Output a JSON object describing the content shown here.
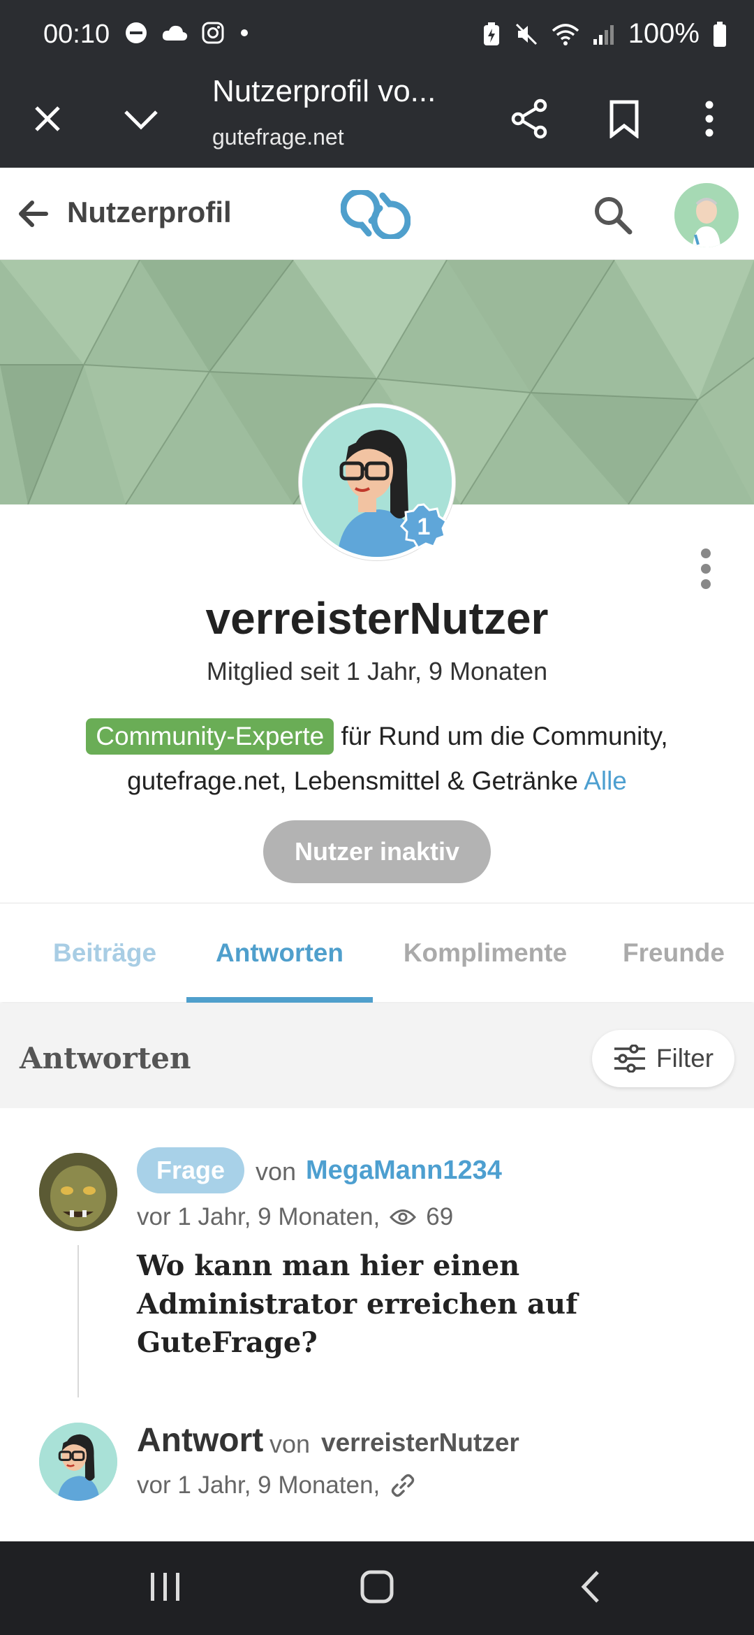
{
  "status_bar": {
    "time": "00:10",
    "battery": "100%"
  },
  "browser": {
    "title": "Nutzerprofil vo...",
    "url": "gutefrage.net"
  },
  "header": {
    "title": "Nutzerprofil"
  },
  "profile": {
    "level": "1",
    "username": "verreisterNutzer",
    "member_since": "Mitglied seit 1 Jahr, 9 Monaten",
    "expert_badge": "Community-Experte",
    "expert_for": "für",
    "expert_topics": "Rund um die Community, gutefrage.net, Lebensmittel & Getränke",
    "all_link": "Alle",
    "inactive_button": "Nutzer inaktiv"
  },
  "tabs": [
    {
      "label": "Beiträge",
      "active": false
    },
    {
      "label": "Antworten",
      "active": true
    },
    {
      "label": "Komplimente",
      "active": false
    },
    {
      "label": "Freunde",
      "active": false
    }
  ],
  "section": {
    "title": "Antworten",
    "filter_label": "Filter"
  },
  "question": {
    "badge": "Frage",
    "von": "von",
    "author": "MegaMann1234",
    "time": "vor 1 Jahr, 9 Monaten,",
    "views": "69",
    "title": "Wo kann man hier einen Administrator erreichen auf GuteFrage?"
  },
  "answer": {
    "label": "Antwort",
    "von": "von",
    "author": "verreisterNutzer",
    "time": "vor 1 Jahr, 9 Monaten,"
  },
  "colors": {
    "accent": "#4f9fcc",
    "expert_green": "#6aad56",
    "frage_badge": "#a8d1e8",
    "status_bar": "#2b2d31"
  }
}
